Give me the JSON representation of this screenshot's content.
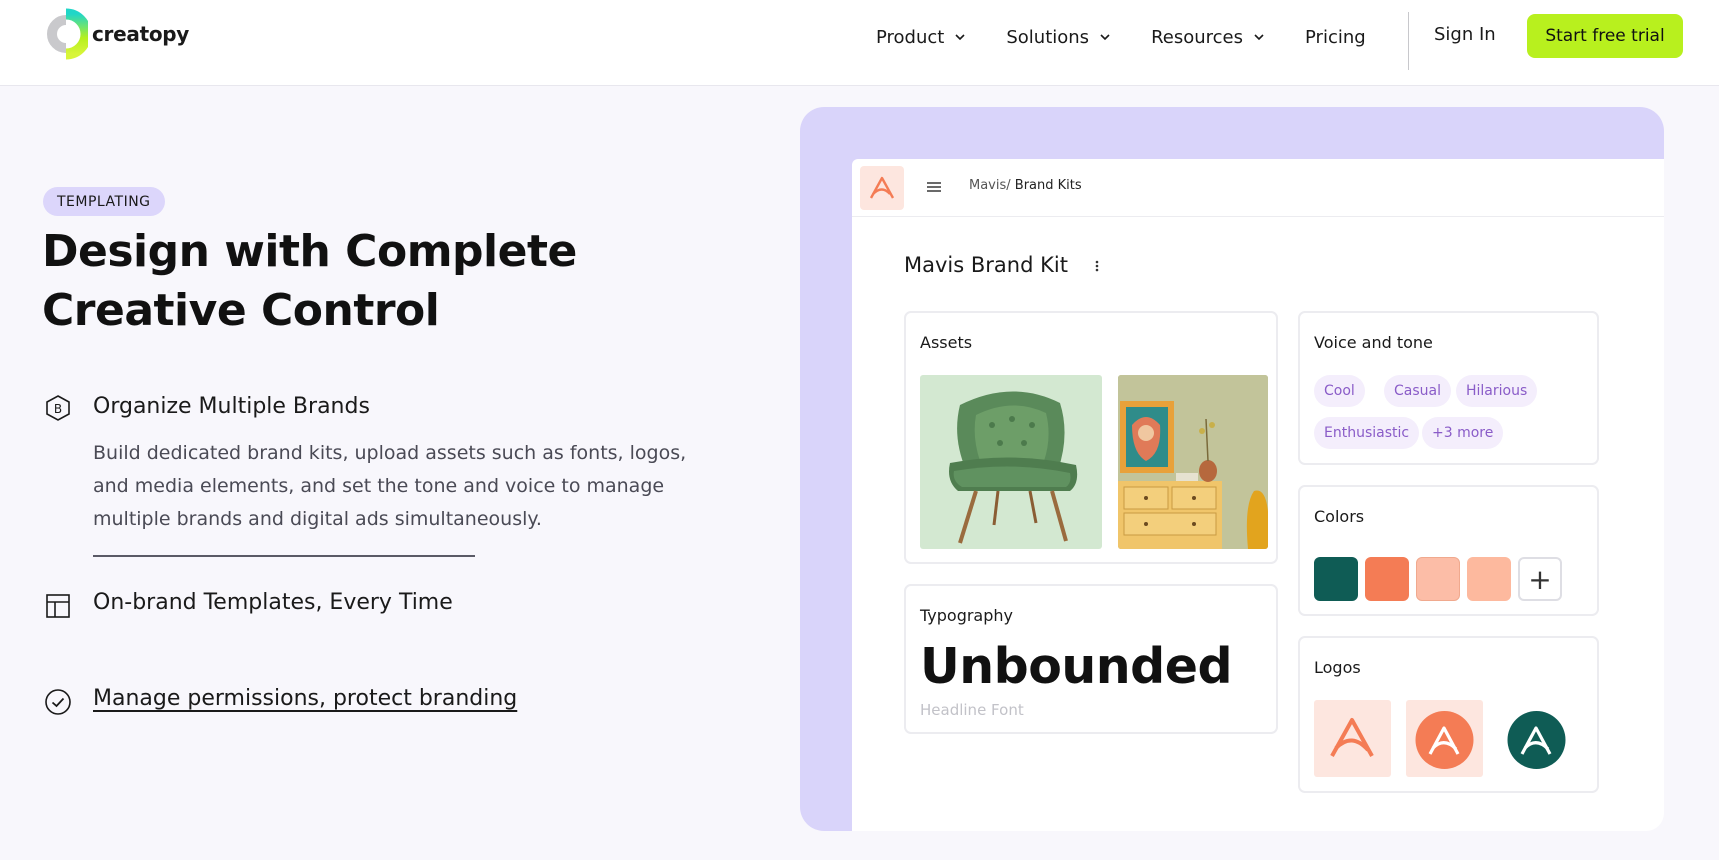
{
  "header": {
    "brand": "creatopy",
    "nav": [
      {
        "label": "Product",
        "has_dropdown": true
      },
      {
        "label": "Solutions",
        "has_dropdown": true
      },
      {
        "label": "Resources",
        "has_dropdown": true
      },
      {
        "label": "Pricing",
        "has_dropdown": false
      }
    ],
    "sign_in": "Sign In",
    "cta": "Start free trial"
  },
  "hero": {
    "badge": "TEMPLATING",
    "title": "Design with Complete Creative Control",
    "features": [
      {
        "icon": "brand-hexagon-icon",
        "title": "Organize Multiple Brands",
        "description": "Build dedicated brand kits, upload assets such as fonts, logos, and media elements, and set the tone and voice to manage multiple brands and digital ads simultaneously."
      },
      {
        "icon": "layout-template-icon",
        "title": "On-brand Templates, Every Time"
      },
      {
        "icon": "check-circle-icon",
        "title": "Manage permissions, protect branding"
      }
    ]
  },
  "mockup": {
    "breadcrumb_parent": "Mavis/",
    "breadcrumb_current": "Brand Kits",
    "kit_title": "Mavis Brand Kit",
    "assets": {
      "title": "Assets"
    },
    "typography": {
      "title": "Typography",
      "font_name": "Unbounded",
      "font_role": "Headline Font"
    },
    "voice": {
      "title": "Voice and tone",
      "tags": [
        "Cool",
        "Casual",
        "Hilarious",
        "Enthusiastic",
        "+3 more"
      ]
    },
    "colors": {
      "title": "Colors",
      "swatches": [
        "#0f5c55",
        "#f47c55",
        "#fcbda7",
        "#fdb99e"
      ],
      "add_label": "+"
    },
    "logos": {
      "title": "Logos"
    }
  },
  "theme": {
    "accent": "#b8f01e",
    "lavender": "#d9d4fa",
    "brand_orange": "#f47c55",
    "brand_teal": "#0f5c55"
  }
}
